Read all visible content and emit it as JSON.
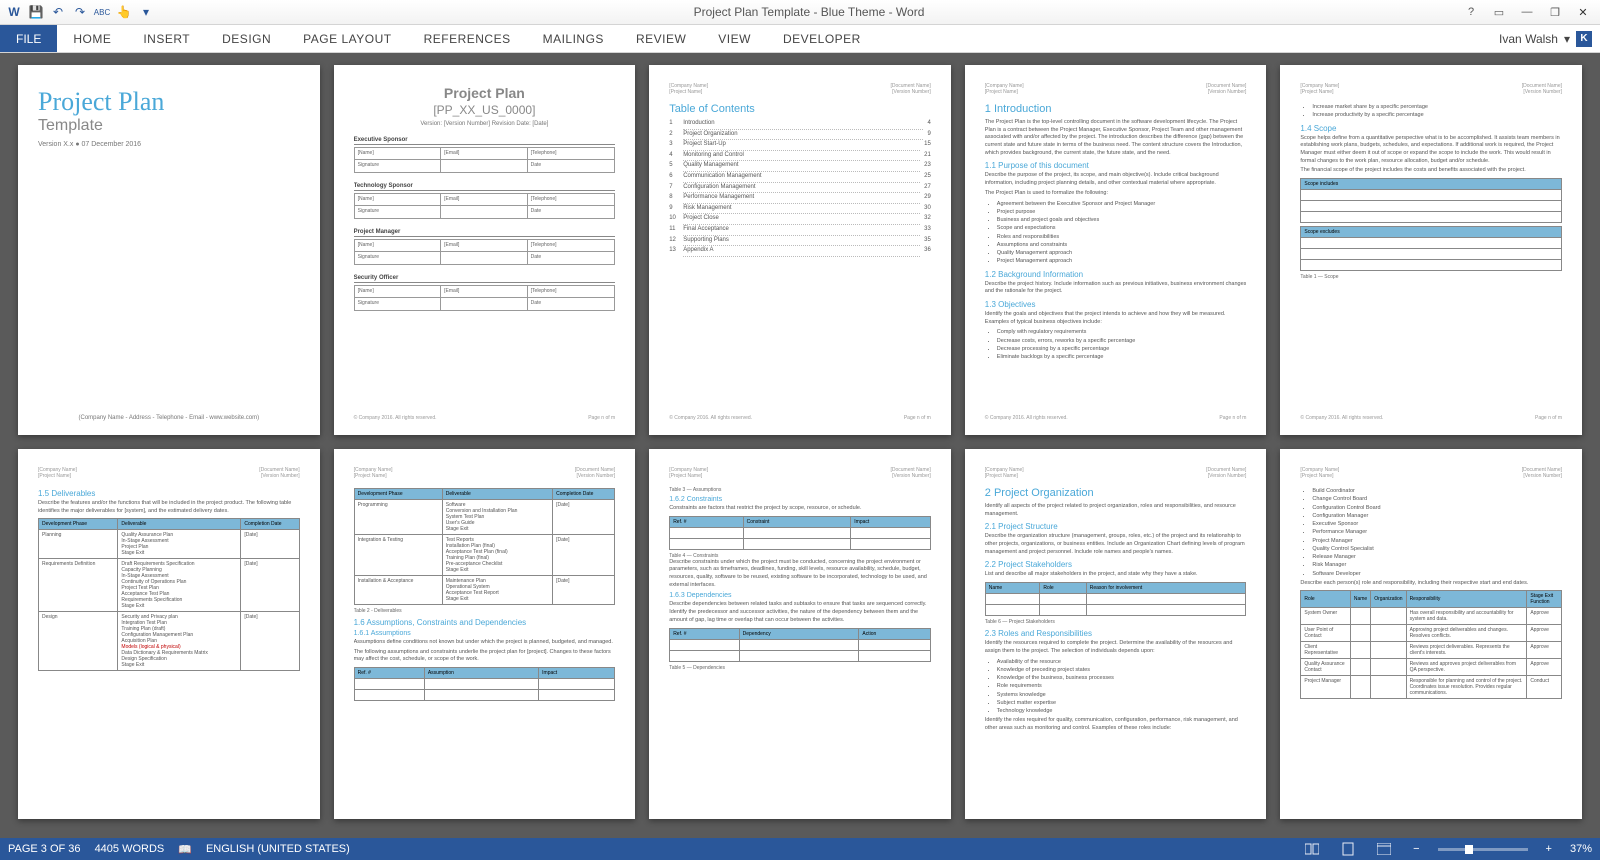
{
  "app": {
    "title": "Project Plan Template - Blue Theme - Word",
    "user": "Ivan Walsh",
    "user_initial": "K"
  },
  "qat": {
    "save": "💾",
    "undo": "↶",
    "redo": "↷",
    "spell": "ABC",
    "touch": "👆"
  },
  "ribbon": {
    "file": "FILE",
    "tabs": [
      "HOME",
      "INSERT",
      "DESIGN",
      "PAGE LAYOUT",
      "REFERENCES",
      "MAILINGS",
      "REVIEW",
      "VIEW",
      "DEVELOPER"
    ]
  },
  "status": {
    "page": "PAGE 3 OF 36",
    "words": "4405 WORDS",
    "lang": "ENGLISH (UNITED STATES)",
    "zoom": "37%"
  },
  "cover": {
    "title": "Project Plan",
    "subtitle": "Template",
    "version": "Version X.x ● 07 December 2016",
    "footer": "(Company Name - Address - Telephone - Email - www.website.com)"
  },
  "signoff": {
    "title": "Project Plan",
    "code": "[PP_XX_US_0000]",
    "ver": "Version: [Version Number]    Revision Date: [Date]",
    "blocks": [
      "Executive Sponsor",
      "Technology Sponsor",
      "Project Manager",
      "Security Officer"
    ],
    "fields": [
      "[Name]",
      "[Email]",
      "[Telephone]",
      "Signature",
      "",
      "Date"
    ]
  },
  "toc": {
    "title": "Table of Contents",
    "items": [
      {
        "n": "1",
        "t": "Introduction",
        "p": "4"
      },
      {
        "n": "2",
        "t": "Project Organization",
        "p": "9"
      },
      {
        "n": "3",
        "t": "Project Start-Up",
        "p": "15"
      },
      {
        "n": "4",
        "t": "Monitoring and Control",
        "p": "21"
      },
      {
        "n": "5",
        "t": "Quality Management",
        "p": "23"
      },
      {
        "n": "6",
        "t": "Communication Management",
        "p": "25"
      },
      {
        "n": "7",
        "t": "Configuration Management",
        "p": "27"
      },
      {
        "n": "8",
        "t": "Performance Management",
        "p": "29"
      },
      {
        "n": "9",
        "t": "Risk Management",
        "p": "30"
      },
      {
        "n": "10",
        "t": "Project Close",
        "p": "32"
      },
      {
        "n": "11",
        "t": "Final Acceptance",
        "p": "33"
      },
      {
        "n": "12",
        "t": "Supporting Plans",
        "p": "35"
      },
      {
        "n": "13",
        "t": "Appendix A",
        "p": "36"
      }
    ]
  },
  "p4": {
    "h1": "1    Introduction",
    "intro": "The Project Plan is the top-level controlling document in the software development lifecycle. The Project Plan is a contract between the Project Manager, Executive Sponsor, Project Team and other management associated with and/or affected by the project. The introduction describes the difference (gap) between the current state and future state in terms of the business need. The content structure covers the Introduction, which provides background, the current state, the future state, and the need.",
    "s11": "1.1    Purpose of this document",
    "s11_txt": "Describe the purpose of the project, its scope, and main objective(s). Include critical background information, including project planning details, and other contextual material where appropriate.",
    "s11_lead": "The Project Plan is used to formalize the following:",
    "s11_list": [
      "Agreement between the Executive Sponsor and Project Manager",
      "Project purpose",
      "Business and project goals and objectives",
      "Scope and expectations",
      "Roles and responsibilities",
      "Assumptions and constraints",
      "Quality Management approach",
      "Project Management approach"
    ],
    "s12": "1.2    Background Information",
    "s12_txt": "Describe the project history. Include information such as previous initiatives, business environment changes and the rationale for the project.",
    "s13": "1.3    Objectives",
    "s13_txt": "Identify the goals and objectives that the project intends to achieve and how they will be measured. Examples of typical business objectives include:",
    "s13_list": [
      "Comply with regulatory requirements",
      "Decrease costs, errors, reworks by a specific percentage",
      "Decrease processing by a specific percentage",
      "Eliminate backlogs by a specific percentage"
    ]
  },
  "p5": {
    "top_list": [
      "Increase market share by a specific percentage",
      "Increase productivity by a specific percentage"
    ],
    "s14": "1.4    Scope",
    "s14_txt": "Scope helps define from a quantitative perspective what is to be accomplished. It assists team members in establishing work plans, budgets, schedules, and expectations. If additional work is required, the Project Manager must either deem it out of scope or expand the scope to include the work. This would result in formal changes to the work plan, resource allocation, budget and/or schedule.",
    "s14_txt2": "The financial scope of the project includes the costs and benefits associated with the project.",
    "inc": "Scope includes",
    "exc": "Scope excludes",
    "cap": "Table 1 — Scope"
  },
  "p6": {
    "s15": "1.5    Deliverables",
    "s15_txt": "Describe the features and/or the functions that will be included in the project product. The following table identifies the major deliverables for [system], and the estimated delivery dates.",
    "headers": [
      "Development Phase",
      "Deliverable",
      "Completion Date"
    ],
    "rows": [
      {
        "phase": "Planning",
        "items": [
          "Quality Assurance Plan",
          "In-Stage Assessment",
          "Project Plan",
          "Stage Exit"
        ],
        "date": "[Date]"
      },
      {
        "phase": "Requirements Definition",
        "items": [
          "Draft Requirements Specification",
          "Capacity Planning",
          "In-Stage Assessment",
          "Continuity of Operations Plan",
          "Project Test Plan",
          "Acceptance Test Plan",
          "Requirements Specification",
          "Stage Exit"
        ],
        "date": "[Date]"
      },
      {
        "phase": "Design",
        "items": [
          "Security and Privacy plan",
          "Integration Test Plan",
          "Training Plan (draft)",
          "Configuration Management Plan",
          "Acquisition Plan",
          "Models (logical & physical)",
          "Data Dictionary & Requirements Matrix",
          "Design Specification",
          "Stage Exit"
        ],
        "date": "[Date]"
      }
    ]
  },
  "p7": {
    "headers": [
      "Development Phase",
      "Deliverable",
      "Completion Date"
    ],
    "rows": [
      {
        "phase": "Programming",
        "items": [
          "Software",
          "Conversion and Installation Plan",
          "System Test Plan",
          "User's Guide",
          "Stage Exit"
        ],
        "date": "[Date]"
      },
      {
        "phase": "Integration & Testing",
        "items": [
          "Test Reports",
          "Installation Plan (final)",
          "Acceptance Test Plan (final)",
          "Training Plan (final)",
          "Pre-acceptance Checklist",
          "Stage Exit"
        ],
        "date": "[Date]"
      },
      {
        "phase": "Installation & Acceptance",
        "items": [
          "Maintenance Plan",
          "Operational System",
          "Acceptance Test Report",
          "Stage Exit"
        ],
        "date": "[Date]"
      }
    ],
    "cap": "Table 2 - Deliverables",
    "s16": "1.6    Assumptions, Constraints and Dependencies",
    "s161": "1.6.1    Assumptions",
    "s161_txt": "Assumptions define conditions not known but under which the project is planned, budgeted, and managed.",
    "s161_txt2": "The following assumptions and constraints underlie the project plan for [project]. Changes to these factors may affect the cost, schedule, or scope of the work.",
    "hdr2": [
      "Ref. #",
      "Assumption",
      "Impact"
    ]
  },
  "p8": {
    "cap1": "Table 3 — Assumptions",
    "s162": "1.6.2    Constraints",
    "s162_txt": "Constraints are factors that restrict the project by scope, resource, or schedule.",
    "hdr1": [
      "Ref. #",
      "Constraint",
      "Impact"
    ],
    "cap2": "Table 4 — Constraints",
    "s162_txt2": "Describe constraints under which the project must be conducted, concerning the project environment or parameters, such as timeframes, deadlines, funding, skill levels, resource availability, schedule, budget, resources, quality, software to be reused, existing software to be incorporated, technology to be used, and external interfaces.",
    "s163": "1.6.3    Dependencies",
    "s163_txt": "Describe dependencies between related tasks and subtasks to ensure that tasks are sequenced correctly. Identify the predecessor and successor activities, the nature of the dependency between them and the amount of gap, lag time or overlap that can occur between the activities.",
    "hdr2": [
      "Ref. #",
      "Dependency",
      "Action"
    ],
    "cap3": "Table 5 — Dependencies"
  },
  "p9": {
    "h1": "2    Project Organization",
    "intro": "Identify all aspects of the project related to project organization, roles and responsibilities, and resource management.",
    "s21": "2.1    Project Structure",
    "s21_txt": "Describe the organization structure (management, groups, roles, etc.) of the project and its relationship to other projects, organizations, or business entities. Include an Organization Chart defining levels of program management and project personnel. Include role names and people's names.",
    "s22": "2.2    Project Stakeholders",
    "s22_txt": "List and describe all major stakeholders in the project, and state why they have a stake.",
    "hdr": [
      "Name",
      "Role",
      "Reason for involvement"
    ],
    "cap": "Table 6 — Project Stakeholders",
    "s23": "2.3    Roles and Responsibilities",
    "s23_txt": "Identify the resources required to complete the project. Determine the availability of the resources and assign them to the project.  The selection of individuals depends upon:",
    "s23_list": [
      "Availability of the resource",
      "Knowledge of preceding project states",
      "Knowledge of the business, business processes",
      "Role requirements",
      "Systems knowledge",
      "Subject matter expertise",
      "Technology knowledge"
    ],
    "s23_txt2": "Identify the roles required for quality, communication, configuration, performance, risk management, and other areas such as monitoring and control. Examples of these roles include:"
  },
  "p10": {
    "roles_list": [
      "Build Coordinator",
      "Change Control Board",
      "Configuration Control Board",
      "Configuration Manager",
      "Executive Sponsor",
      "Performance Manager",
      "Project Manager",
      "Quality Control Specialist",
      "Release Manager",
      "Risk Manager",
      "Software Developer"
    ],
    "txt": "Describe each person(s) role and responsibility, including their respective start and end dates.",
    "hdr": [
      "Role",
      "Name",
      "Organization",
      "Responsibility",
      "Stage Exit Function"
    ],
    "rows": [
      {
        "role": "System Owner",
        "resp": "Has overall responsibility and accountability for system and data.",
        "fn": "Approve"
      },
      {
        "role": "User Point of Contact",
        "resp": "Approving project deliverables and changes. Resolves conflicts.",
        "fn": "Approve"
      },
      {
        "role": "Client Representative",
        "resp": "Reviews project deliverables. Represents the client's interests.",
        "fn": "Approve"
      },
      {
        "role": "Quality Assurance Contact",
        "resp": "Reviews and approves project deliverables from QA perspective.",
        "fn": "Approve"
      },
      {
        "role": "Project Manager",
        "resp": "Responsible for planning and control of the project. Coordinates issue resolution. Provides regular communications.",
        "fn": "Conduct"
      }
    ]
  },
  "hdr_meta": {
    "l1": "[Company Name]",
    "l2": "[Project Name]",
    "r1": "[Document Name]",
    "r2": "[Version Number]"
  },
  "ftr_meta": {
    "l": "© Company 2016. All rights reserved.",
    "r": "Page n of m"
  }
}
